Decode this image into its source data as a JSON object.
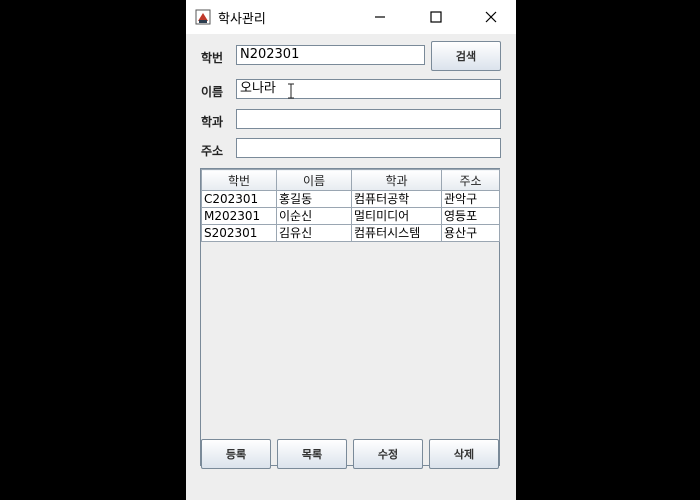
{
  "window": {
    "title": "학사관리"
  },
  "form": {
    "student_id_label": "학번",
    "student_id_value": "N202301",
    "search_button": "검색",
    "name_label": "이름",
    "name_value": "오나라",
    "dept_label": "학과",
    "dept_value": "",
    "address_label": "주소",
    "address_value": ""
  },
  "table": {
    "headers": [
      "학번",
      "이름",
      "학과",
      "주소"
    ],
    "rows": [
      [
        "C202301",
        "홍길동",
        "컴퓨터공학",
        "관악구"
      ],
      [
        "M202301",
        "이순신",
        "멀티미디어",
        "영등포"
      ],
      [
        "S202301",
        "김유신",
        "컴퓨터시스템",
        "용산구"
      ]
    ]
  },
  "actions": {
    "register": "등록",
    "list": "목록",
    "edit": "수정",
    "delete": "삭제"
  }
}
